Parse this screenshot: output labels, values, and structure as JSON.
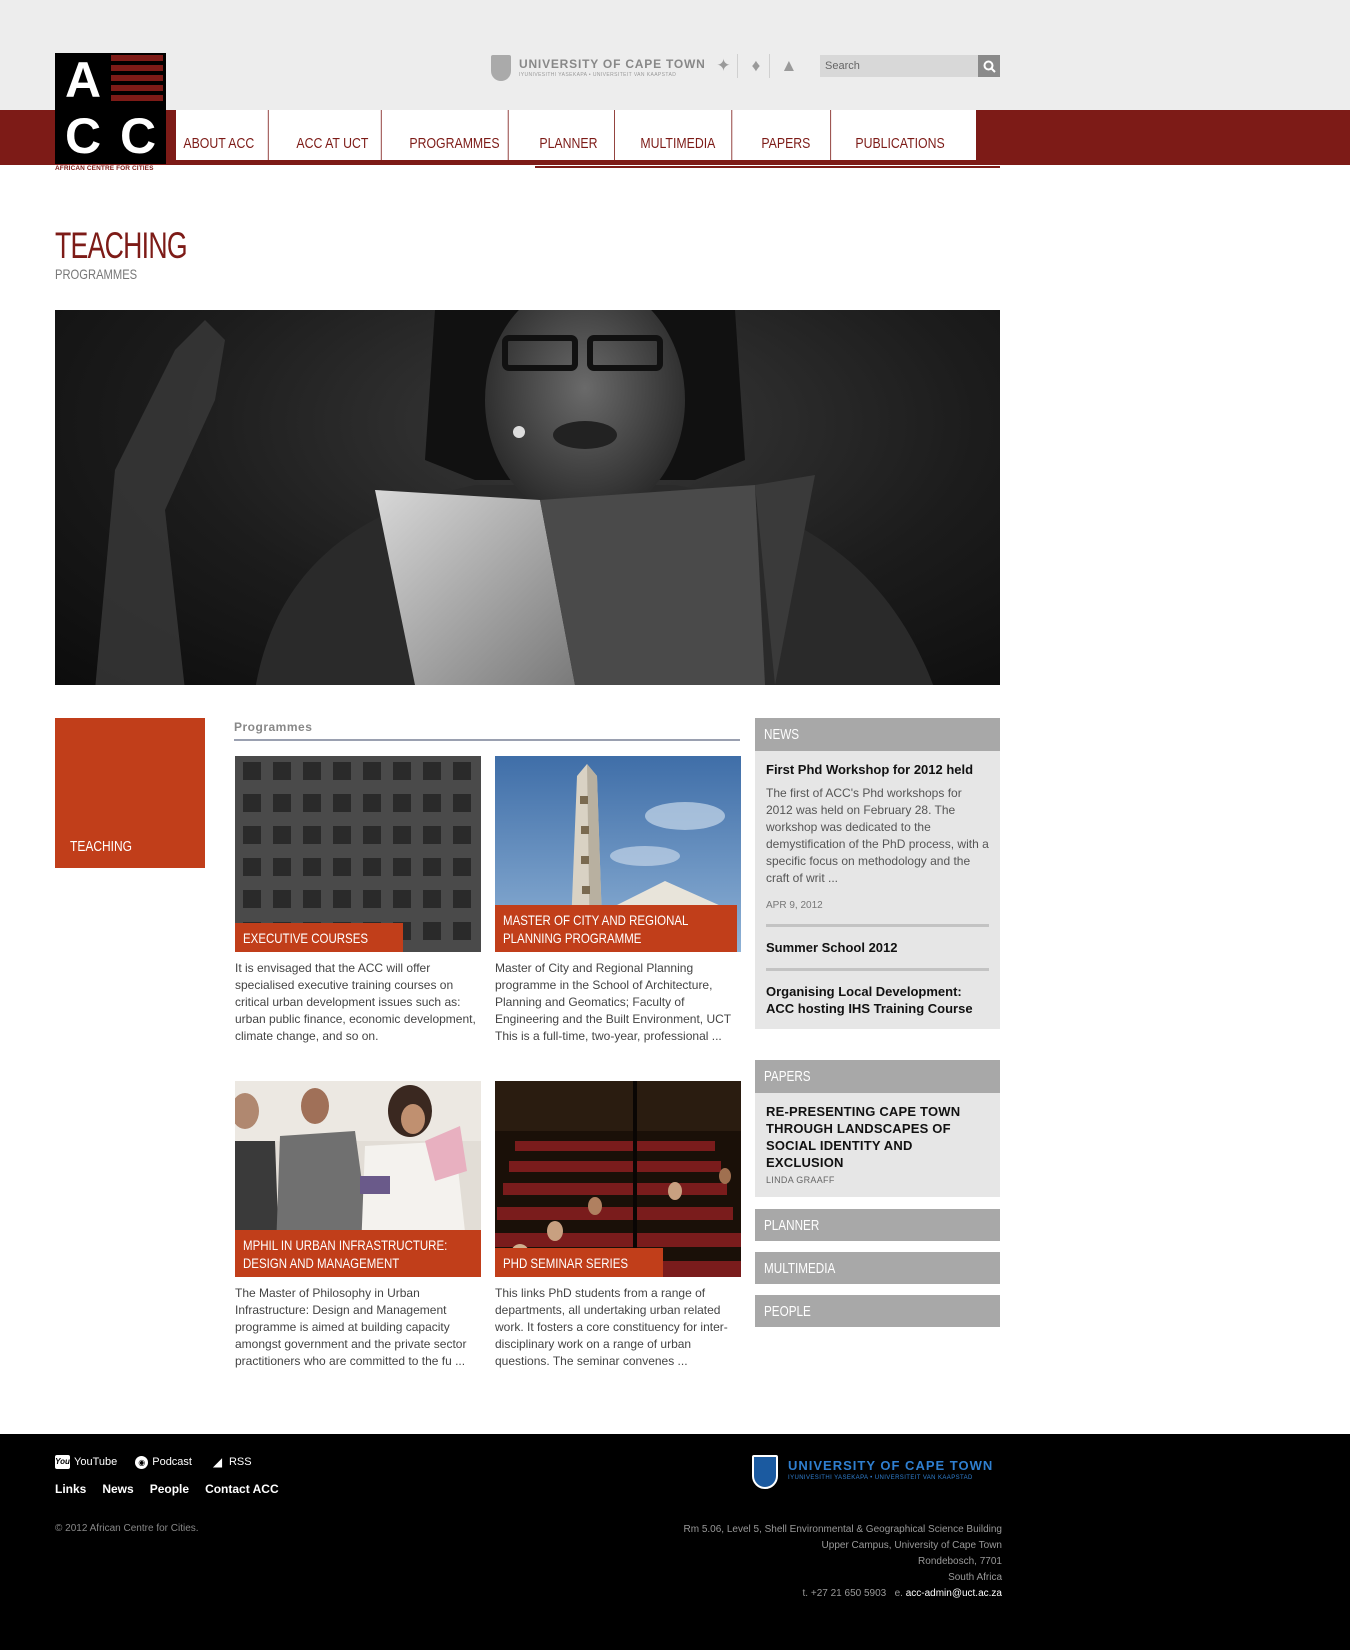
{
  "brand": {
    "logo_letters": [
      "A",
      "C",
      "C"
    ],
    "logo_caption": "AFRICAN CENTRE FOR CITIES",
    "accent_color": "#7d1b17",
    "orange_color": "#c13e1a"
  },
  "header": {
    "uct_name": "UNIVERSITY OF CAPE TOWN",
    "uct_sub": "IYUNIVESITHI YASEKAPA • UNIVERSITEIT VAN KAAPSTAD",
    "social_icons": [
      "bird-icon",
      "twitter-icon",
      "africa-map-icon"
    ],
    "search_placeholder": "Search"
  },
  "nav": {
    "items": [
      {
        "label": "ABOUT ACC"
      },
      {
        "label": "ACC AT UCT"
      },
      {
        "label": "PROGRAMMES"
      },
      {
        "label": "PLANNER"
      },
      {
        "label": "MULTIMEDIA"
      },
      {
        "label": "PAPERS"
      },
      {
        "label": "PUBLICATIONS"
      }
    ]
  },
  "page": {
    "title": "TEACHING",
    "subtitle": "PROGRAMMES"
  },
  "sidebar": {
    "label": "TEACHING"
  },
  "programmes": {
    "heading": "Programmes",
    "cards": [
      {
        "caption_lines": [
          "EXECUTIVE COURSES"
        ],
        "text": "It is envisaged that the ACC will offer specialised executive training courses on critical urban development issues such as: urban public finance, economic development, climate change, and so on."
      },
      {
        "caption_lines": [
          "MASTER OF CITY AND REGIONAL",
          "PLANNING PROGRAMME"
        ],
        "text": "Master of City and Regional Planning programme in the School of Architecture, Planning and Geomatics; Faculty of Engineering and the Built Environment, UCT This is a full-time, two-year, professional ..."
      },
      {
        "caption_lines": [
          "MPHIL IN URBAN INFRASTRUCTURE:",
          "DESIGN AND MANAGEMENT"
        ],
        "text": "The Master of Philosophy in Urban Infrastructure: Design and Management programme is aimed at building capacity amongst government and the private sector practitioners who are committed to the fu ..."
      },
      {
        "caption_lines": [
          "PHD SEMINAR SERIES"
        ],
        "text": "This links PhD students from a range of departments, all undertaking urban related work. It fosters a core constituency for inter-disciplinary work on a range of urban questions. The seminar convenes ..."
      }
    ]
  },
  "news": {
    "heading": "NEWS",
    "featured": {
      "title": "First Phd Workshop for 2012 held",
      "text": "The first of ACC's Phd workshops for 2012 was held on February 28. The workshop was dedicated to the demystification of the PhD process, with a specific focus on methodology and the craft of writ ...",
      "date": "APR 9, 2012"
    },
    "items": [
      {
        "title": "Summer School 2012"
      },
      {
        "title": "Organising Local Development: ACC hosting IHS Training Course"
      }
    ]
  },
  "papers": {
    "heading": "PAPERS",
    "title": "RE-PRESENTING CAPE TOWN THROUGH LANDSCAPES OF SOCIAL IDENTITY AND EXCLUSION",
    "author": "LINDA GRAAFF"
  },
  "side_links": [
    {
      "label": "PLANNER"
    },
    {
      "label": "MULTIMEDIA"
    },
    {
      "label": "PEOPLE"
    }
  ],
  "footer": {
    "social": [
      {
        "label": "YouTube",
        "icon": "youtube-icon"
      },
      {
        "label": "Podcast",
        "icon": "podcast-icon"
      },
      {
        "label": "RSS",
        "icon": "rss-icon"
      }
    ],
    "links": [
      "Links",
      "News",
      "People",
      "Contact ACC"
    ],
    "copyright": "© 2012 African Centre for Cities.",
    "uct_name": "UNIVERSITY OF CAPE TOWN",
    "uct_sub": "IYUNIVESITHI YASEKAPA • UNIVERSITEIT VAN KAAPSTAD",
    "address_lines": [
      "Rm 5.06, Level 5, Shell Environmental & Geographical Science Building",
      "Upper Campus, University of Cape Town",
      "Rondebosch, 7701",
      "South Africa"
    ],
    "phone": "t. +27 21 650 5903",
    "email_prefix": "e.",
    "email": "acc-admin@uct.ac.za"
  }
}
